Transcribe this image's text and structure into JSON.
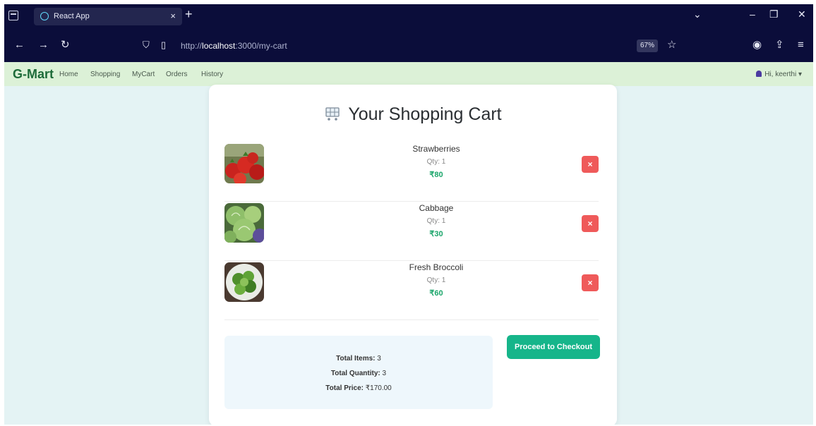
{
  "browser": {
    "tab_title": "React App",
    "tab_close": "×",
    "new_tab": "+",
    "url_prefix": "http://",
    "url_host": "localhost",
    "url_path": ":3000/my-cart",
    "zoom": "67%",
    "icons": [
      "tab-list-icon",
      "react-logo-icon",
      "back-arrow-icon",
      "forward-arrow-icon",
      "reload-icon",
      "shield-icon",
      "page-icon",
      "bookmark-star-icon",
      "account-icon",
      "extensions-icon",
      "menu-icon",
      "minimize-icon",
      "restore-icon",
      "close-icon"
    ]
  },
  "app": {
    "brand": "G-Mart",
    "nav": [
      "Home",
      "Shopping",
      "MyCart",
      "Orders",
      "History"
    ],
    "user_menu": "Hi, keerthi ▾"
  },
  "cart": {
    "title": "Your Shopping Cart",
    "items": [
      {
        "name": "Strawberries",
        "qty": "Qty: 1",
        "price": "₹80",
        "remove": "×"
      },
      {
        "name": "Cabbage",
        "qty": "Qty: 1",
        "price": "₹30",
        "remove": "×"
      },
      {
        "name": "Fresh Broccoli",
        "qty": "Qty: 1",
        "price": "₹60",
        "remove": "×"
      }
    ],
    "summary": {
      "items_label": "Total Items:",
      "items_value": "3",
      "quantity_label": "Total Quantity:",
      "quantity_value": "3",
      "price_label": "Total Price:",
      "price_value": "₹170.00"
    },
    "checkout_label": "Proceed to Checkout"
  },
  "colors": {
    "brand_green": "#1d6b39",
    "price_green": "#1aa56a",
    "checkout_button": "#16b58a",
    "remove_button": "#ef5a5a",
    "browser_chrome": "#0b0d3a",
    "app_header": "#dcf1d7",
    "page_background": "#e4f3f4"
  }
}
